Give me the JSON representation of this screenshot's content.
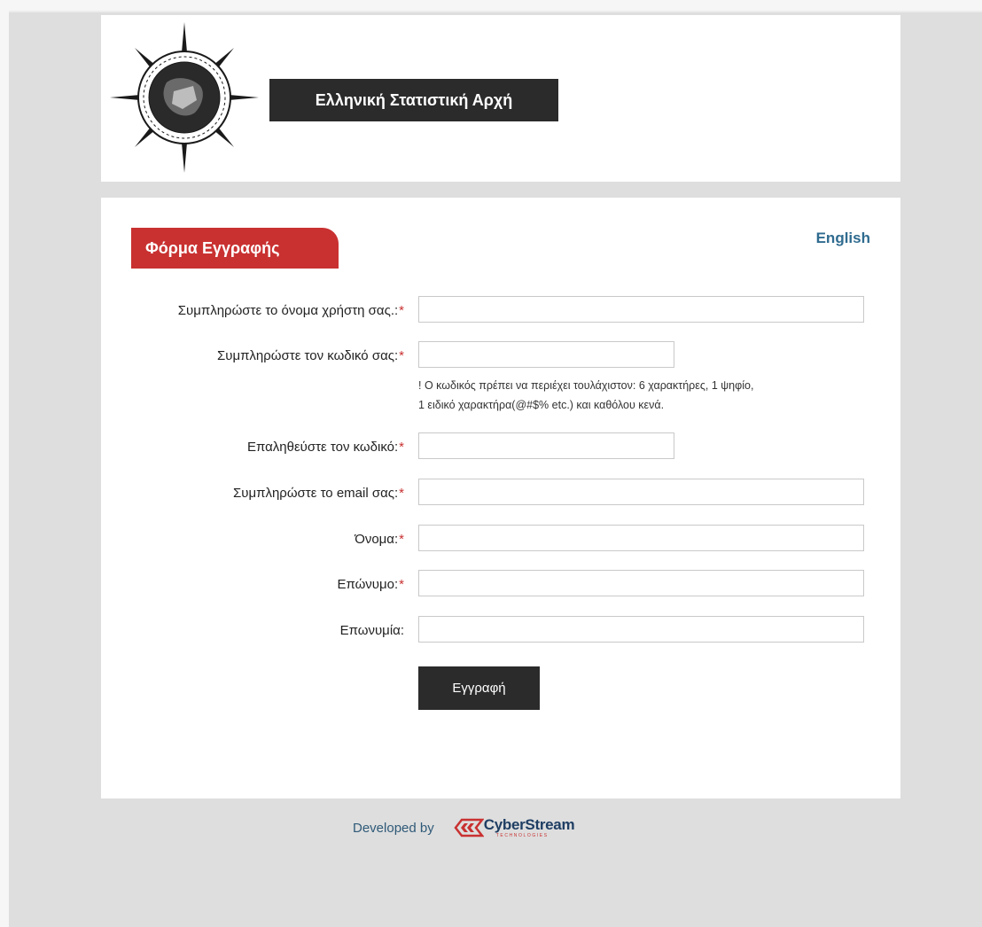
{
  "header": {
    "site_title": "Ελληνική Στατιστική Αρχή",
    "logo_icon": "elstat-compass-seal-icon"
  },
  "form": {
    "tab_title": "Φόρμα Εγγραφής",
    "language_link": "English",
    "fields": [
      {
        "label": "Συμπληρώστε το όνομα χρήστη σας.:",
        "required": true,
        "value": "",
        "placeholder": ""
      },
      {
        "label": "Συμπληρώστε τον κωδικό σας:",
        "required": true,
        "value": "",
        "placeholder": ""
      },
      {
        "label": "Επαληθεύστε τον κωδικό:",
        "required": true,
        "value": "",
        "placeholder": ""
      },
      {
        "label": "Συμπληρώστε το email σας:",
        "required": true,
        "value": "",
        "placeholder": ""
      },
      {
        "label": "Όνομα:",
        "required": true,
        "value": "",
        "placeholder": ""
      },
      {
        "label": "Επώνυμο:",
        "required": true,
        "value": "",
        "placeholder": ""
      },
      {
        "label": "Επωνυμία:",
        "required": false,
        "value": "",
        "placeholder": ""
      }
    ],
    "required_marker": "*",
    "password_hint_line1": "! Ο κωδικός πρέπει να περιέχει τουλάχιστον: 6 χαρακτήρες, 1 ψηφίο,",
    "password_hint_line2": "1 ειδικό χαρακτήρα(@#$% etc.) και καθόλου κενά.",
    "submit_label": "Εγγραφή"
  },
  "footer": {
    "developed_by": "Developed by",
    "brand_name": "CyberStream",
    "brand_sub": "TECHNOLOGIES",
    "brand_icon": "cyberstream-logo-icon"
  },
  "colors": {
    "accent_red": "#c93131",
    "dark": "#2b2b2b",
    "link_blue": "#2f6b8f"
  }
}
